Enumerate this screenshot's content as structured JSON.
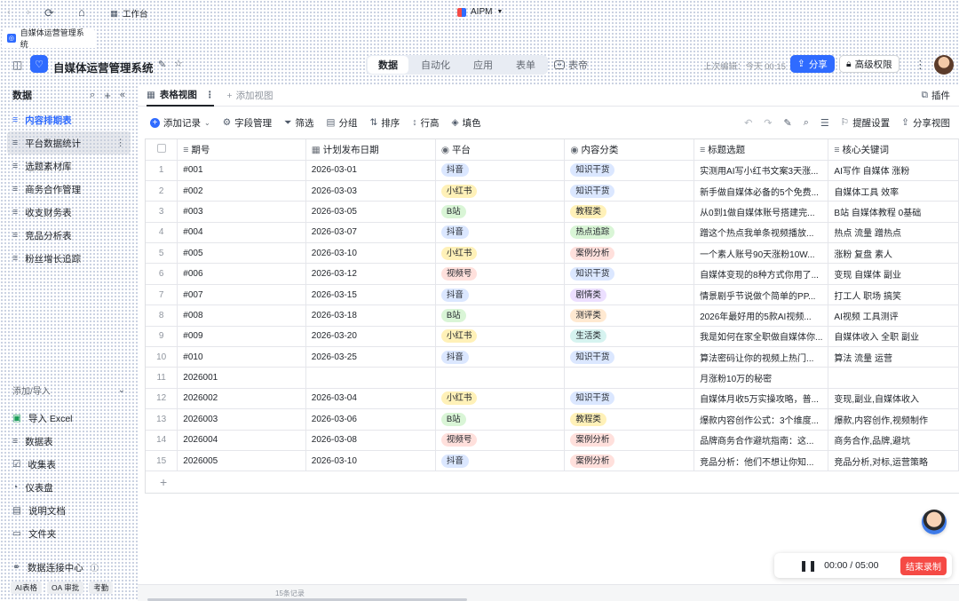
{
  "browser": {
    "workspace_label": "工作台",
    "app_name": "AIPM",
    "tab_title": "自媒体运营管理系统"
  },
  "header": {
    "title": "自媒体运营管理系统",
    "mode_tabs": [
      "数据",
      "自动化",
      "应用",
      "表单"
    ],
    "mode_active": 0,
    "dashboard_label": "表帝",
    "last_edit": "上次编辑：今天 00:15",
    "share_label": "分享",
    "adv_label": "高级权限"
  },
  "sidebar": {
    "title": "数据",
    "tables": [
      {
        "label": "内容排期表",
        "active": true
      },
      {
        "label": "平台数据统计",
        "hover": true
      },
      {
        "label": "选题素材库"
      },
      {
        "label": "商务合作管理"
      },
      {
        "label": "收支财务表"
      },
      {
        "label": "竞品分析表"
      },
      {
        "label": "粉丝增长追踪"
      }
    ],
    "add_section_title": "添加/导入",
    "add_items": [
      {
        "label": "导入 Excel",
        "icon": "excel-icon"
      },
      {
        "label": "数据表",
        "icon": "table-icon"
      },
      {
        "label": "收集表",
        "icon": "form-icon"
      },
      {
        "label": "仪表盘",
        "icon": "dashboard-icon"
      },
      {
        "label": "说明文档",
        "icon": "doc-icon"
      },
      {
        "label": "文件夹",
        "icon": "folder-icon"
      }
    ],
    "data_center_label": "数据连接中心",
    "footer_chips": [
      "AI表格",
      "OA 审批",
      "考勤"
    ]
  },
  "view": {
    "tab_label": "表格视图",
    "add_view": "添加视图",
    "plugin": "插件"
  },
  "toolbar": {
    "add_record": "添加记录",
    "field_manage": "字段管理",
    "filter": "筛选",
    "group": "分组",
    "sort": "排序",
    "row_height": "行高",
    "fill_color": "填色",
    "remind": "提醒设置",
    "share_view": "分享视图"
  },
  "columns": [
    "期号",
    "计划发布日期",
    "平台",
    "内容分类",
    "标题选题",
    "核心关键词"
  ],
  "rows": [
    {
      "n": "1",
      "id": "#001",
      "date": "2026-03-01",
      "platform": "抖音",
      "cat": "知识干货",
      "title": "实测用AI写小红书文案3天涨...",
      "kw": "AI写作 自媒体 涨粉"
    },
    {
      "n": "2",
      "id": "#002",
      "date": "2026-03-03",
      "platform": "小红书",
      "cat": "知识干货",
      "title": "新手做自媒体必备的5个免费...",
      "kw": "自媒体工具 效率"
    },
    {
      "n": "3",
      "id": "#003",
      "date": "2026-03-05",
      "platform": "B站",
      "cat": "教程类",
      "title": "从0到1做自媒体账号搭建完...",
      "kw": "B站 自媒体教程 0基础"
    },
    {
      "n": "4",
      "id": "#004",
      "date": "2026-03-07",
      "platform": "抖音",
      "cat": "热点追踪",
      "title": "蹭这个热点我单条视频播放...",
      "kw": "热点 流量 蹭热点"
    },
    {
      "n": "5",
      "id": "#005",
      "date": "2026-03-10",
      "platform": "小红书",
      "cat": "案例分析",
      "title": "一个素人账号90天涨粉10W...",
      "kw": "涨粉 复盘 素人"
    },
    {
      "n": "6",
      "id": "#006",
      "date": "2026-03-12",
      "platform": "视频号",
      "cat": "知识干货",
      "title": "自媒体变现的8种方式你用了...",
      "kw": "变现 自媒体 副业"
    },
    {
      "n": "7",
      "id": "#007",
      "date": "2026-03-15",
      "platform": "抖音",
      "cat": "剧情类",
      "title": "情景剧乎节说做个简单的PP...",
      "kw": "打工人 职场 搞笑"
    },
    {
      "n": "8",
      "id": "#008",
      "date": "2026-03-18",
      "platform": "B站",
      "cat": "测评类",
      "title": "2026年最好用的5款AI视频...",
      "kw": "AI视频 工具测评"
    },
    {
      "n": "9",
      "id": "#009",
      "date": "2026-03-20",
      "platform": "小红书",
      "cat": "生活类",
      "title": "我是如何在家全职做自媒体你...",
      "kw": "自媒体收入 全职 副业"
    },
    {
      "n": "10",
      "id": "#010",
      "date": "2026-03-25",
      "platform": "抖音",
      "cat": "知识干货",
      "title": "算法密码让你的视频上热门...",
      "kw": "算法 流量 运营"
    },
    {
      "n": "11",
      "id": "2026001",
      "date": "",
      "platform": "",
      "cat": "",
      "title": "月涨粉10万的秘密",
      "kw": ""
    },
    {
      "n": "12",
      "id": "2026002",
      "date": "2026-03-04",
      "platform": "小红书",
      "cat": "知识干货",
      "title": "自媒体月收5万实操攻略，普...",
      "kw": "变现,副业,自媒体收入"
    },
    {
      "n": "13",
      "id": "2026003",
      "date": "2026-03-06",
      "platform": "B站",
      "cat": "教程类",
      "title": "爆款内容创作公式：3个维度...",
      "kw": "爆款,内容创作,视频制作"
    },
    {
      "n": "14",
      "id": "2026004",
      "date": "2026-03-08",
      "platform": "视频号",
      "cat": "案例分析",
      "title": "品牌商务合作避坑指南：这...",
      "kw": "商务合作,品牌,避坑"
    },
    {
      "n": "15",
      "id": "2026005",
      "date": "2026-03-10",
      "platform": "抖音",
      "cat": "案例分析",
      "title": "竞品分析：他们不想让你知...",
      "kw": "竞品分析,对标,运营策略"
    }
  ],
  "platform_colors": {
    "抖音": "#dbe7ff",
    "小红书": "#fff1b8",
    "B站": "#d9f5d6",
    "视频号": "#ffe0dc"
  },
  "category_colors": {
    "知识干货": "#dbe7ff",
    "教程类": "#fff1b8",
    "热点追踪": "#d9f5d6",
    "案例分析": "#ffe0dc",
    "剧情类": "#ecdfff",
    "测评类": "#ffe9d1",
    "生活类": "#d6f3f0"
  },
  "status": {
    "count": "15条记录"
  },
  "player": {
    "time": "00:00",
    "total": "05:00",
    "end_label": "结束录制"
  },
  "accent": "#2f6bff"
}
